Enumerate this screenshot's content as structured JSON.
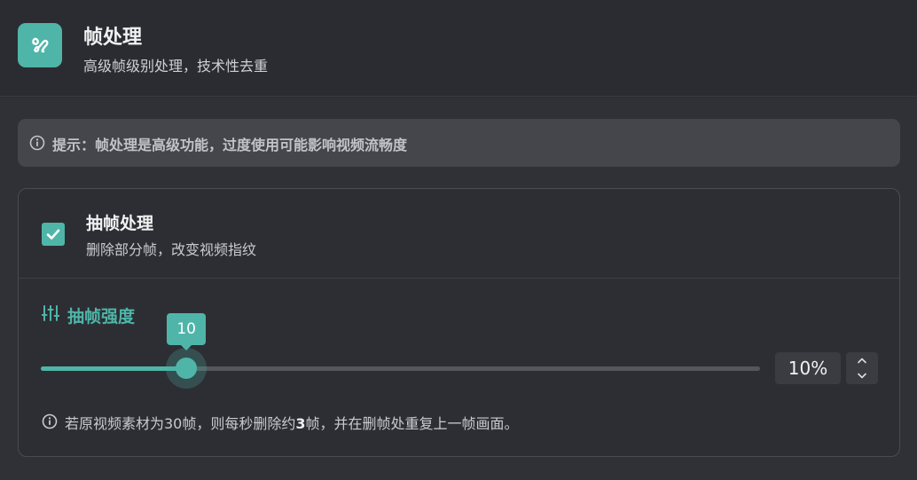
{
  "header": {
    "icon": "frame-process-icon",
    "title": "帧处理",
    "subtitle": "高级帧级别处理，技术性去重"
  },
  "tip": {
    "icon": "info-icon",
    "text": "提示：帧处理是高级功能，过度使用可能影响视频流畅度"
  },
  "frame_drop": {
    "checked": true,
    "title": "抽帧处理",
    "description": "删除部分帧，改变视频指纹"
  },
  "strength": {
    "icon": "sliders-icon",
    "label": "抽帧强度",
    "value": 10,
    "min": 0,
    "max": 50,
    "tooltip": "10",
    "display": "10%"
  },
  "note": {
    "icon": "info-icon",
    "prefix": "若原视频素材为30帧，则每秒删除约",
    "highlight": "3",
    "suffix": "帧，并在删帧处重复上一帧画面。"
  },
  "colors": {
    "accent": "#4fb5a9",
    "background": "#2b2c31",
    "panel": "#303136"
  }
}
